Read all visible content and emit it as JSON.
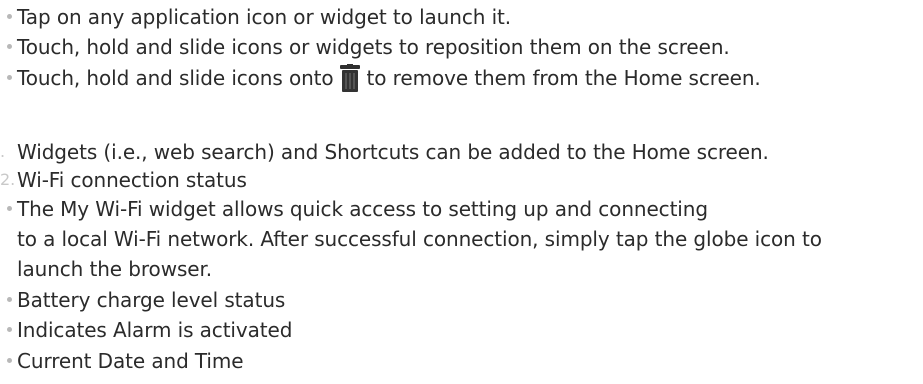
{
  "bullets_group1": [
    "Tap on any application icon or widget to launch it.",
    "Touch, hold and slide icons or widgets to reposition them on the screen."
  ],
  "trash_line": {
    "before": "Touch, hold and slide icons onto",
    "icon": "trash-icon",
    "after": "to remove them from the Home screen."
  },
  "numbered": [
    {
      "marker": ".",
      "text": "Widgets (i.e., web search) and Shortcuts can be added to the Home screen."
    },
    {
      "marker": "2.",
      "text": "Wi-Fi connection status"
    }
  ],
  "wifi_widget": [
    "The My Wi-Fi widget allows quick access to setting up and connecting",
    "to a local Wi-Fi network. After successful connection, simply tap the globe icon to",
    "launch the browser."
  ],
  "bullets_group2": [
    "Battery charge level status",
    "Indicates Alarm is activated",
    "Current Date and Time"
  ],
  "colors": {
    "text": "#2b2b2b",
    "bullet": "#b8b8b8",
    "trash_icon": "#333333"
  }
}
